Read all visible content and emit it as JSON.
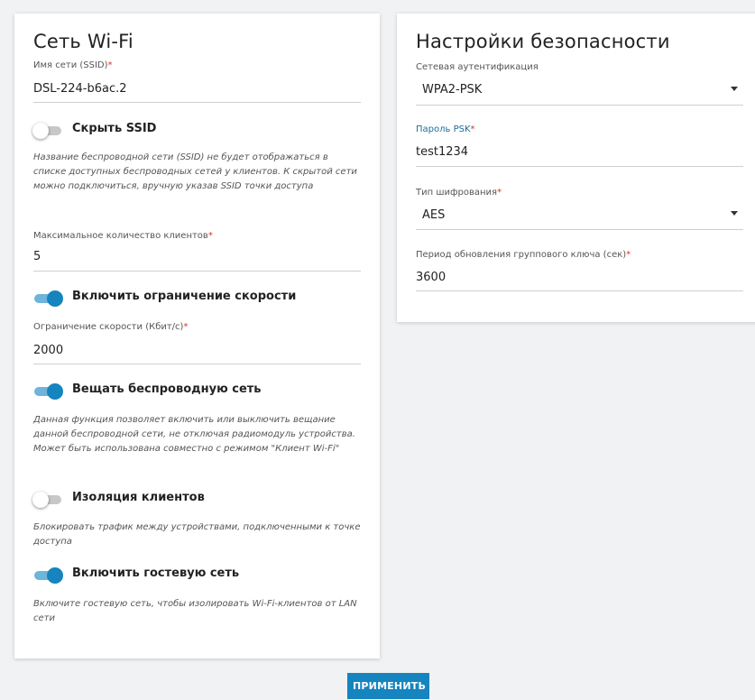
{
  "wifi": {
    "title": "Сеть Wi-Fi",
    "ssid_label": "Имя сети (SSID)",
    "ssid_value": "DSL-224-b6ac.2",
    "hide_ssid": {
      "label": "Скрыть SSID",
      "on": false
    },
    "hide_ssid_hint": "Название беспроводной сети (SSID) не будет отображаться в списке доступных беспроводных сетей у клиентов. К скрытой сети можно подключиться, вручную указав SSID точки доступа",
    "max_clients_label": "Максимальное количество клиентов",
    "max_clients_value": "5",
    "speed_limit": {
      "label": "Включить ограничение скорости",
      "on": true
    },
    "speed_limit_field_label": "Ограничение скорости (Кбит/с)",
    "speed_limit_value": "2000",
    "broadcast": {
      "label": "Вещать беспроводную сеть",
      "on": true
    },
    "broadcast_hint": "Данная функция позволяет включить или выключить вещание данной беспроводной сети, не отключая радиомодуль устройства. Может быть использована совместно с режимом \"Клиент Wi-Fi\"",
    "isolation": {
      "label": "Изоляция клиентов",
      "on": false
    },
    "isolation_hint": "Блокировать трафик между устройствами, подключенными к точке доступа",
    "guest": {
      "label": "Включить гостевую сеть",
      "on": true
    },
    "guest_hint": "Включите гостевую сеть, чтобы изолировать Wi-Fi-клиентов от LAN сети"
  },
  "security": {
    "title": "Настройки безопасности",
    "auth_label": "Сетевая аутентификация",
    "auth_value": "WPA2-PSK",
    "psk_label": "Пароль PSK",
    "psk_value": "test1234",
    "cipher_label": "Тип шифрования",
    "cipher_value": "AES",
    "rekey_label": "Период обновления группового ключа (сек)",
    "rekey_value": "3600"
  },
  "required_mark": "*",
  "apply_label": "ПРИМЕНИТЬ",
  "colors": {
    "accent": "#1584bf",
    "accent_light": "#6eb4db",
    "required": "#d9332b",
    "background": "#f1f2f3"
  }
}
